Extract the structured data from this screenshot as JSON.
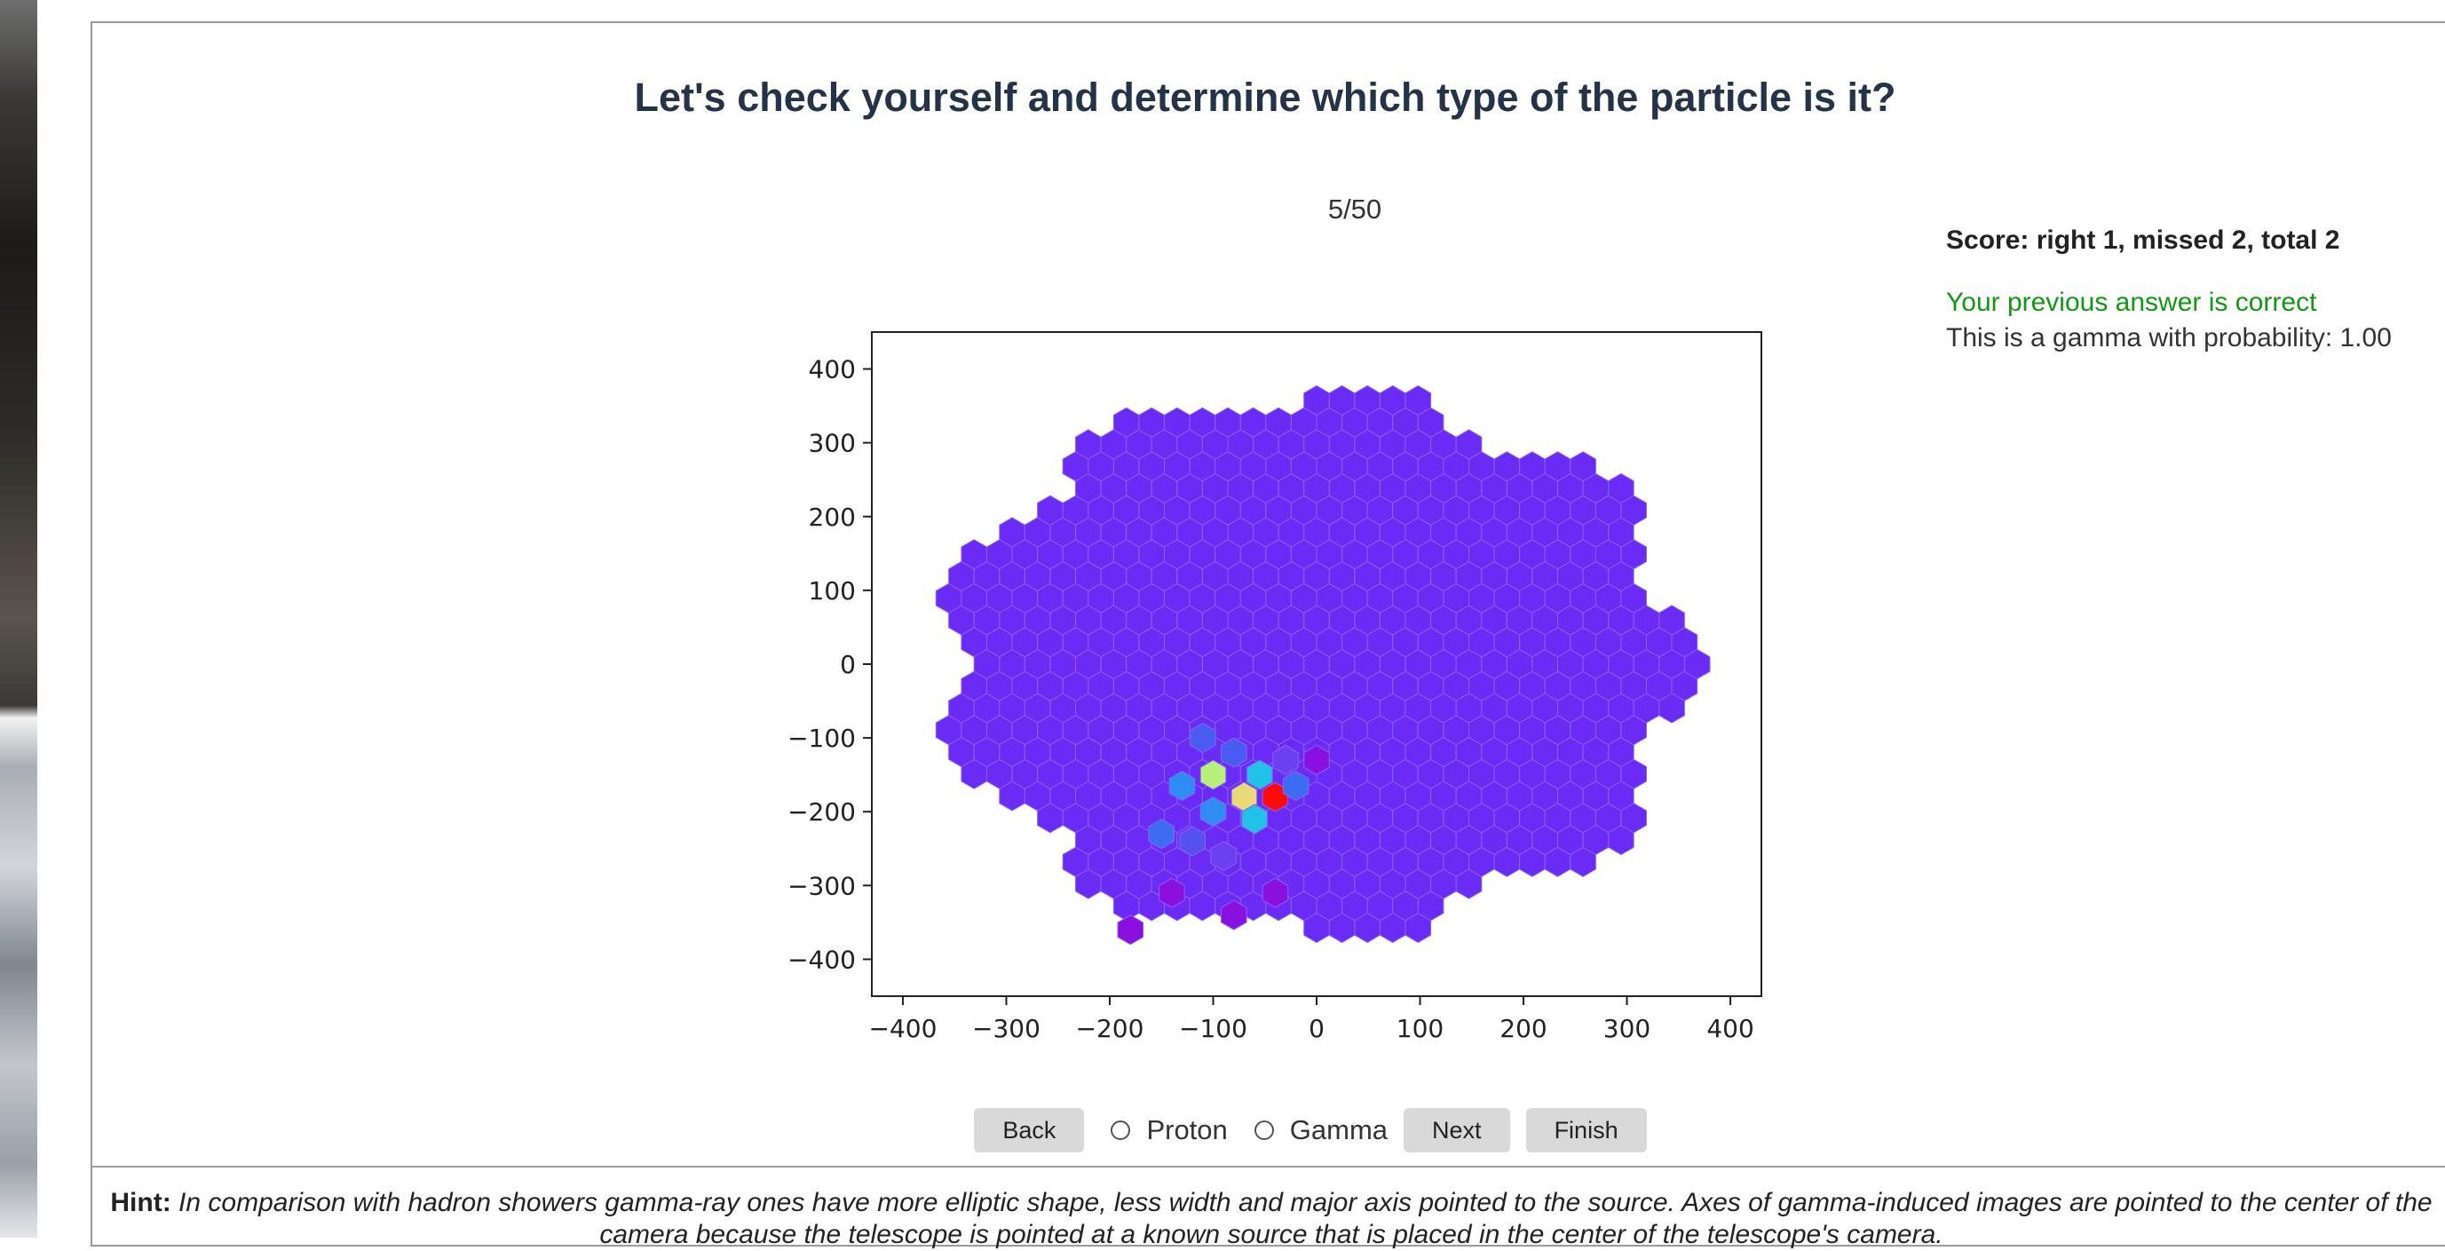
{
  "quiz": {
    "title": "Let's check yourself and determine which type of the particle is it?",
    "progress": "5/50",
    "score": "Score: right 1, missed 2, total 2",
    "feedback": "Your previous answer is correct",
    "probability": "This is a gamma with probability: 1.00"
  },
  "controls": {
    "back_label": "Back",
    "proton_label": "Proton",
    "gamma_label": "Gamma",
    "next_label": "Next",
    "finish_label": "Finish"
  },
  "hint": {
    "label": "Hint:",
    "text": "In comparison with hadron showers gamma-ray ones have more elliptic shape, less width and major axis pointed to the source. Axes of gamma-induced images are pointed to the center of the camera because the telescope is pointed at a known source that is placed in the center of the telescope's camera."
  },
  "colors": {
    "base_pixel": "#6a2bf5",
    "title": "#22334a",
    "correct": "#119911"
  },
  "chart_data": {
    "type": "heatmap",
    "title": "",
    "xlabel": "",
    "ylabel": "",
    "xlim": [
      -430,
      430
    ],
    "ylim": [
      -450,
      450
    ],
    "x_ticks": [
      -400,
      -300,
      -200,
      -100,
      0,
      100,
      200,
      300,
      400
    ],
    "y_ticks": [
      400,
      300,
      200,
      100,
      0,
      -100,
      -200,
      -300,
      -400
    ],
    "base_color": "#6a2bf5",
    "hot_pixels": [
      {
        "x": -100,
        "y": -150,
        "value": 0.7,
        "color": "#b7f07a"
      },
      {
        "x": -70,
        "y": -180,
        "value": 0.65,
        "color": "#e9d97a"
      },
      {
        "x": -40,
        "y": -180,
        "value": 1.0,
        "color": "#ff0a0a"
      },
      {
        "x": -55,
        "y": -150,
        "value": 0.45,
        "color": "#22c2e6"
      },
      {
        "x": -60,
        "y": -210,
        "value": 0.45,
        "color": "#22c2e6"
      },
      {
        "x": -130,
        "y": -165,
        "value": 0.3,
        "color": "#2f8cf2"
      },
      {
        "x": -100,
        "y": -200,
        "value": 0.3,
        "color": "#2f8cf2"
      },
      {
        "x": -20,
        "y": -165,
        "value": 0.25,
        "color": "#3c6cf0"
      },
      {
        "x": -80,
        "y": -120,
        "value": 0.22,
        "color": "#4a5cf0"
      },
      {
        "x": -110,
        "y": -100,
        "value": 0.2,
        "color": "#4a5cf0"
      },
      {
        "x": -150,
        "y": -230,
        "value": 0.25,
        "color": "#3c6cf0"
      },
      {
        "x": -120,
        "y": -240,
        "value": 0.15,
        "color": "#5550f0"
      },
      {
        "x": -90,
        "y": -260,
        "value": 0.12,
        "color": "#6a40f0"
      },
      {
        "x": -30,
        "y": -130,
        "value": 0.12,
        "color": "#6a40f0"
      },
      {
        "x": 0,
        "y": -130,
        "value": 0.1,
        "color": "#8a10e0"
      },
      {
        "x": -140,
        "y": -310,
        "value": 0.1,
        "color": "#8a10e0"
      },
      {
        "x": -40,
        "y": -310,
        "value": 0.1,
        "color": "#8a10e0"
      },
      {
        "x": -180,
        "y": -360,
        "value": 0.1,
        "color": "#8a10e0"
      },
      {
        "x": -80,
        "y": -340,
        "value": 0.1,
        "color": "#8a10e0"
      }
    ]
  }
}
